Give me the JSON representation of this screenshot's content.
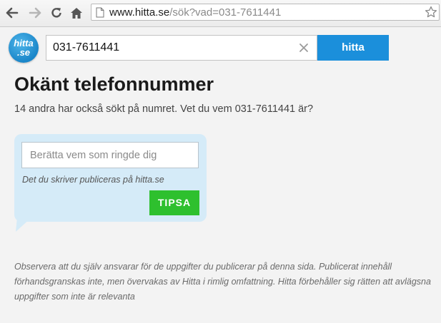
{
  "browser": {
    "url_host": "www.hitta.se",
    "url_path": "/sök?vad=031-7611441",
    "icons": [
      "back-arrow-icon",
      "forward-arrow-icon",
      "reload-icon",
      "home-icon",
      "page-icon",
      "star-icon"
    ]
  },
  "header": {
    "logo_line1": "hitta",
    "logo_line2": ".se",
    "search_value": "031-7611441",
    "search_button": "hitta"
  },
  "main": {
    "title": "Okänt telefonnummer",
    "subtitle": "14 andra har också sökt på numret. Vet du vem 031-7611441 är?",
    "tip": {
      "placeholder": "Berätta vem som ringde dig",
      "note": "Det du skriver publiceras på hitta.se",
      "button": "TIPSA"
    },
    "disclaimer": "Observera att du själv ansvarar för de uppgifter du publicerar på denna sida. Publicerat innehåll förhandsgranskas inte, men övervakas av Hitta i rimlig omfattning. Hitta förbehåller sig rätten att avlägsna uppgifter som inte är relevanta"
  },
  "colors": {
    "brand_blue": "#1b8fdb",
    "tip_green": "#2ec02e",
    "tip_bubble": "#d5ebf8"
  }
}
